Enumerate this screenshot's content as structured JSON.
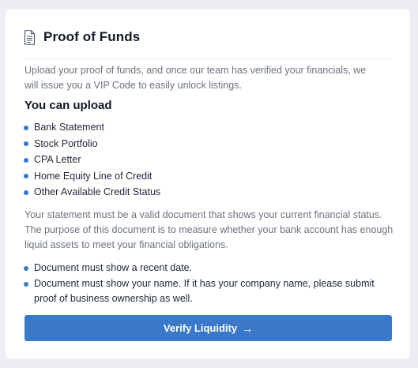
{
  "card": {
    "title": "Proof of Funds",
    "title_icon": "document-icon",
    "intro": "Upload your proof of funds, and once our team has verified your financials, we will issue you a VIP Code to easily unlock listings.",
    "upload_heading": "You can upload",
    "upload_items": [
      "Bank Statement",
      "Stock Portfolio",
      "CPA Letter",
      "Home Equity Line of Credit",
      "Other Available Credit Status"
    ],
    "statement": "Your statement must be a valid document that shows your current financial status. The purpose of this document is to measure whether your bank account has enough liquid assets to meet your financial obligations.",
    "requirements": [
      "Document must show a recent date.",
      "Document must show your name. If it has your company name, please submit proof of business ownership as well."
    ],
    "button_label": "Verify Liquidity",
    "button_arrow": "→"
  },
  "colors": {
    "accent": "#3a78c9",
    "background": "#eceef1",
    "card": "#ffffff",
    "muted_text": "#6b7280",
    "heading_text": "#111827"
  }
}
